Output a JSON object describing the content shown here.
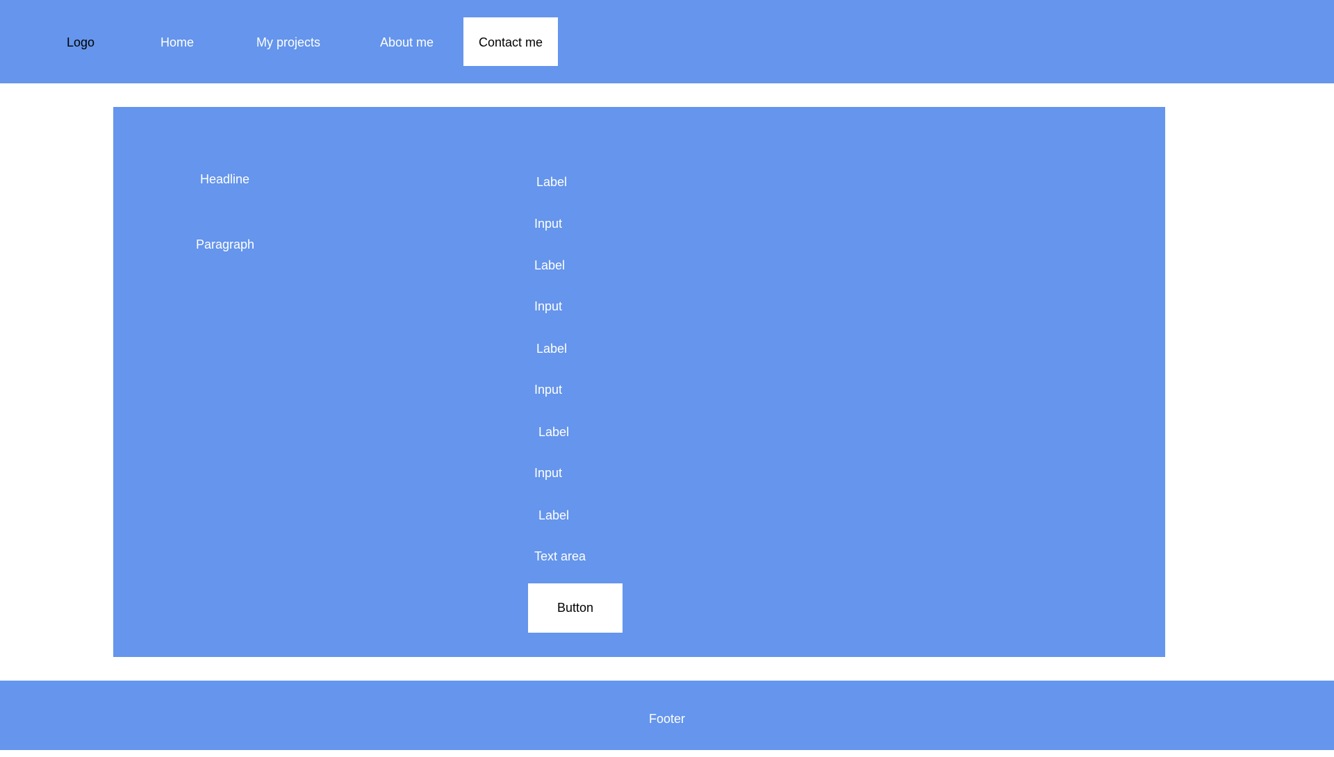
{
  "colors": {
    "primary": "#6595ec",
    "surface": "#ffffff",
    "text_light": "#ffffff",
    "text_dark": "#000000"
  },
  "header": {
    "logo": "Logo",
    "nav": [
      {
        "label": "Home"
      },
      {
        "label": "My projects"
      },
      {
        "label": "About me"
      },
      {
        "label": "Contact me",
        "active": true
      }
    ]
  },
  "main": {
    "headline": "Headline",
    "paragraph": "Paragraph",
    "form": {
      "fields": [
        {
          "label": "Label",
          "input": "Input"
        },
        {
          "label": "Label",
          "input": "Input"
        },
        {
          "label": "Label",
          "input": "Input"
        },
        {
          "label": "Label",
          "input": "Input"
        },
        {
          "label": "Label",
          "input": "Text area"
        }
      ],
      "button": "Button"
    }
  },
  "footer": {
    "text": "Footer"
  }
}
